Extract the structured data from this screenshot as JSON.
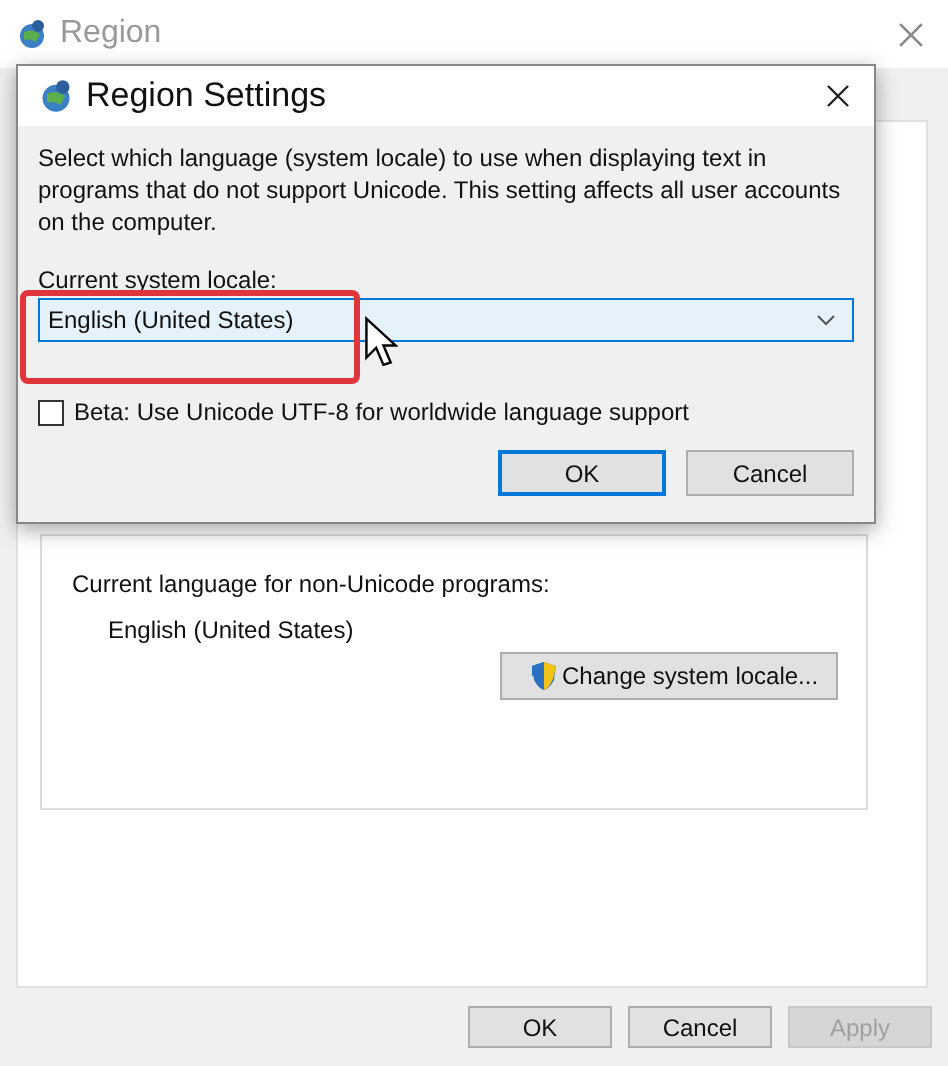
{
  "window": {
    "title": "Region"
  },
  "dialog": {
    "title": "Region Settings",
    "description": "Select which language (system locale) to use when displaying text in programs that do not support Unicode. This setting affects all user accounts on the computer.",
    "locale_label": "Current system locale:",
    "locale_select": {
      "value": "English (United States)"
    },
    "beta_option": {
      "label": "Beta: Use Unicode UTF-8 for worldwide language support",
      "checked": false
    },
    "buttons": [
      {
        "label": "OK",
        "default": true
      },
      {
        "label": "Cancel",
        "default": false
      }
    ]
  },
  "language_section": {
    "label": "Current language for non-Unicode programs:",
    "value": "English (United States)",
    "button": "Change system locale..."
  },
  "buttons": [
    {
      "label": "OK",
      "disabled": false
    },
    {
      "label": "Cancel",
      "disabled": false
    },
    {
      "label": "Apply",
      "disabled": true
    }
  ]
}
